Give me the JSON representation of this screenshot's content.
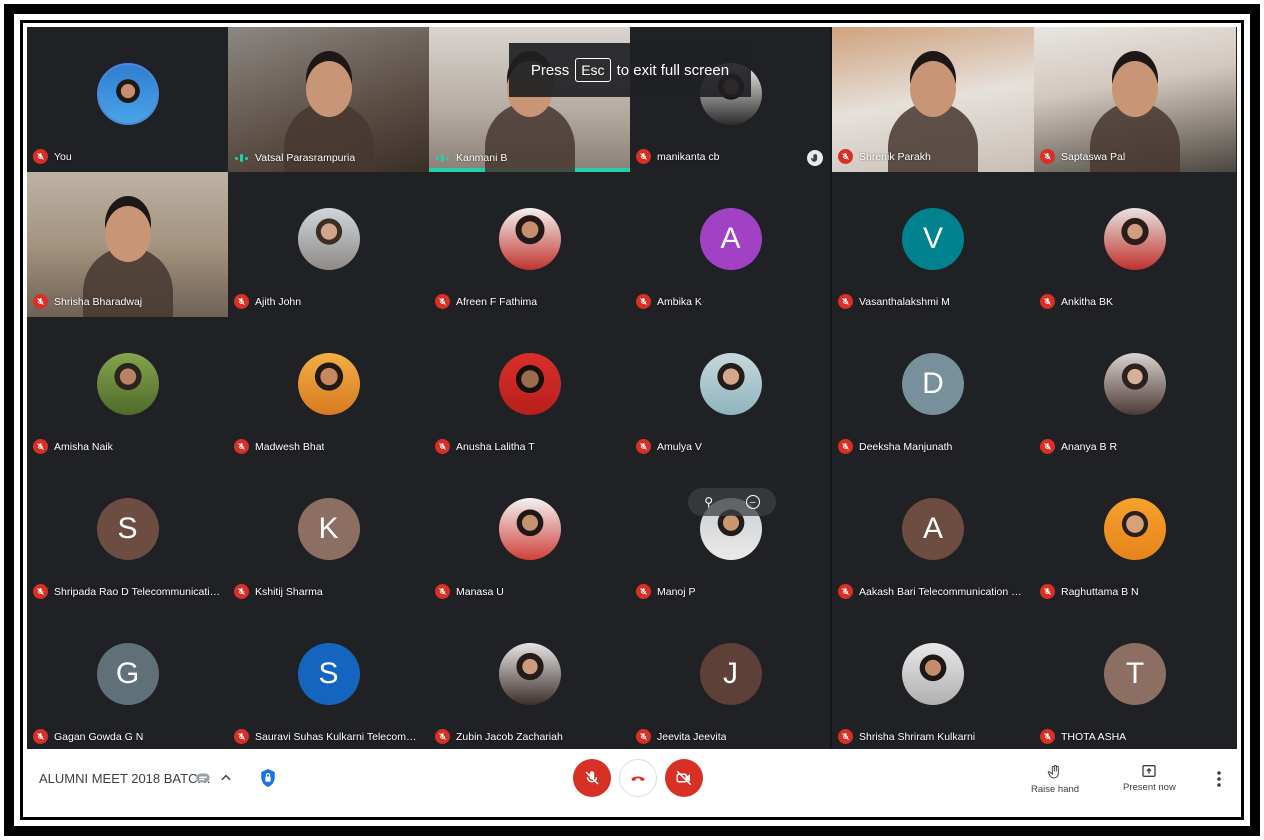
{
  "toast": {
    "press": "Press",
    "key": "Esc",
    "message": "to exit full screen"
  },
  "tiles_left": [
    {
      "name": "You",
      "kind": "avatar",
      "avatar": "you",
      "muted": true
    },
    {
      "name": "Vatsal Parasrampuria",
      "kind": "video",
      "video": "v1",
      "muted": false,
      "speaking": true
    },
    {
      "name": "Kanmani B",
      "kind": "video",
      "video": "v2",
      "muted": false,
      "speaking": true,
      "active": true
    },
    {
      "name": "manikanta cb",
      "kind": "avatar",
      "avatar": "p12",
      "muted": true,
      "hand": true
    },
    {
      "name": "Shrisha Bharadwaj",
      "kind": "video",
      "video": "v5",
      "muted": true
    },
    {
      "name": "Ajith John",
      "kind": "avatar",
      "avatar": "photo",
      "muted": true
    },
    {
      "name": "Afreen F Fathima",
      "kind": "avatar",
      "avatar": "p2",
      "muted": true
    },
    {
      "name": "Ambika K",
      "kind": "letter",
      "letter": "A",
      "color": "#a142c4",
      "muted": true
    },
    {
      "name": "Amisha Naik",
      "kind": "avatar",
      "avatar": "p3",
      "muted": true
    },
    {
      "name": "Madwesh Bhat",
      "kind": "avatar",
      "avatar": "p4",
      "muted": true
    },
    {
      "name": "Anusha Lalitha T",
      "kind": "avatar",
      "avatar": "p5",
      "muted": true
    },
    {
      "name": "Amulya V",
      "kind": "avatar",
      "avatar": "p6",
      "muted": true
    },
    {
      "name": "Shripada Rao D Telecommunication En...",
      "kind": "letter",
      "letter": "S",
      "color": "#6d4c41",
      "muted": true
    },
    {
      "name": "Kshitij Sharma",
      "kind": "letter",
      "letter": "K",
      "color": "#8d6e63",
      "muted": true
    },
    {
      "name": "Manasa U",
      "kind": "avatar",
      "avatar": "p8",
      "muted": true
    },
    {
      "name": "Manoj P",
      "kind": "avatar",
      "avatar": "p9",
      "muted": true,
      "hover": true
    },
    {
      "name": "Gagan Gowda G N",
      "kind": "letter",
      "letter": "G",
      "color": "#607078",
      "muted": true
    },
    {
      "name": "Sauravi Suhas Kulkarni Telecommunic...",
      "kind": "letter",
      "letter": "S",
      "color": "#1565c0",
      "muted": true
    },
    {
      "name": "Zubin Jacob Zachariah",
      "kind": "avatar",
      "avatar": "p14",
      "muted": true
    },
    {
      "name": "Jeevita Jeevita",
      "kind": "letter",
      "letter": "J",
      "color": "#5d4037",
      "muted": true
    }
  ],
  "tiles_right": [
    {
      "name": "Shrenik Parakh",
      "kind": "video",
      "video": "v3",
      "muted": true
    },
    {
      "name": "Saptaswa Pal",
      "kind": "video",
      "video": "v4",
      "muted": true
    },
    {
      "name": "Vasanthalakshmi M",
      "kind": "letter",
      "letter": "V",
      "color": "#00838f",
      "muted": true
    },
    {
      "name": "Ankitha BK",
      "kind": "avatar",
      "avatar": "p13",
      "muted": true
    },
    {
      "name": "Deeksha Manjunath",
      "kind": "letter",
      "letter": "D",
      "color": "#78909c",
      "muted": true
    },
    {
      "name": "Ananya B R",
      "kind": "avatar",
      "avatar": "p7",
      "muted": true
    },
    {
      "name": "Aakash Bari Telecommunication Engin...",
      "kind": "letter",
      "letter": "A",
      "color": "#6d4c41",
      "muted": true
    },
    {
      "name": "Raghuttama B N",
      "kind": "avatar",
      "avatar": "p10",
      "muted": true
    },
    {
      "name": "Shrisha Shriram Kulkarni",
      "kind": "avatar",
      "avatar": "p15",
      "muted": true
    },
    {
      "name": "THOTA ASHA",
      "kind": "letter",
      "letter": "T",
      "color": "#8d6e63",
      "muted": true
    }
  ],
  "bottombar": {
    "meeting_title": "ALUMNI MEET 2018 BATCH.",
    "raise_hand": "Raise hand",
    "present_now": "Present now"
  },
  "colors": {
    "mic_off": "#d93025",
    "speaking": "#1fd1ac",
    "background": "#202124"
  },
  "icons": [
    "mic-off-icon",
    "hand-icon",
    "chevron-up-icon",
    "shield-icon",
    "end-call-icon",
    "camera-off-icon",
    "present-icon",
    "more-vert-icon",
    "chat-icon"
  ]
}
